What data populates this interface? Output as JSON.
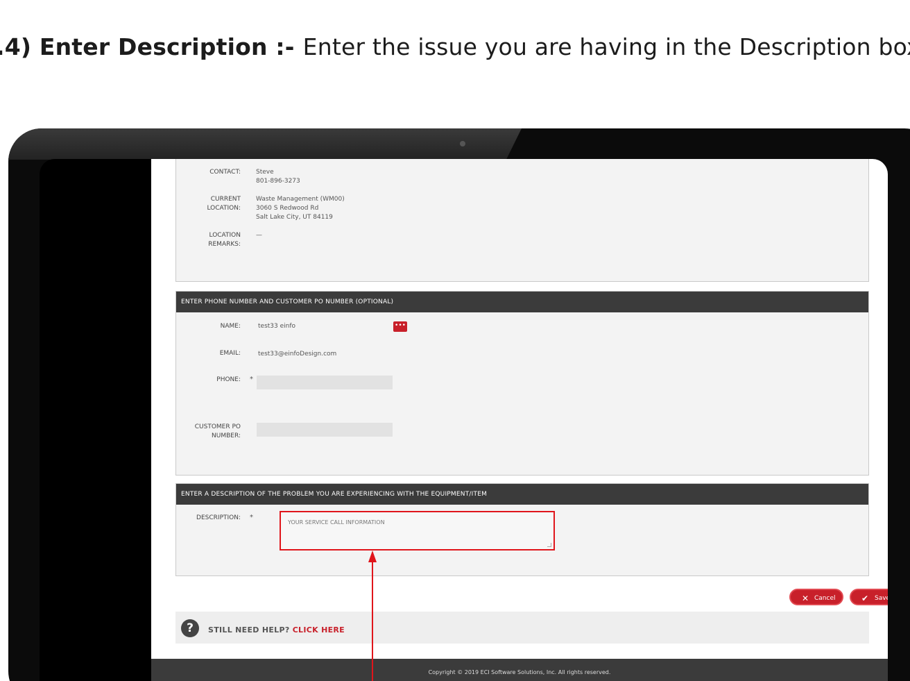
{
  "instruction": {
    "step": ".4) Enter Description :-",
    "text": "Enter the issue you are having in the Description box."
  },
  "location_panel": {
    "contact_label": "CONTACT:",
    "contact_name": "Steve",
    "contact_phone": "801-896-3273",
    "current_location_label_1": "CURRENT",
    "current_location_label_2": "LOCATION:",
    "location_line_1": "Waste Management (WM00)",
    "location_line_2": "3060 S Redwood Rd",
    "location_line_3": "Salt Lake City, UT 84119",
    "location_remarks_label_1": "LOCATION",
    "location_remarks_label_2": "REMARKS:",
    "location_remarks_value": "—"
  },
  "phone_panel": {
    "header": "ENTER PHONE NUMBER AND CUSTOMER PO NUMBER (OPTIONAL)",
    "name_label": "NAME:",
    "name_value": "test33 einfo",
    "more_button": "•••",
    "email_label": "EMAIL:",
    "email_value": "test33@einfoDesign.com",
    "phone_label": "PHONE:",
    "required_marker": "*",
    "phone_value": "",
    "po_label_1": "CUSTOMER PO",
    "po_label_2": "NUMBER:",
    "po_value": ""
  },
  "description_panel": {
    "header": "ENTER A DESCRIPTION OF THE PROBLEM YOU ARE EXPERIENCING WITH THE EQUIPMENT/ITEM",
    "description_label": "DESCRIPTION:",
    "required_marker": "*",
    "placeholder": "YOUR SERVICE CALL INFORMATION"
  },
  "actions": {
    "cancel_label": "Cancel",
    "save_label": "Save"
  },
  "help": {
    "text": "STILL NEED HELP?",
    "link": "CLICK HERE"
  },
  "footer": {
    "copyright": "Copyright © 2019 ECI Software Solutions, Inc. All rights reserved."
  },
  "colors": {
    "accent_red": "#c8202a",
    "annotation_red": "#e0151b",
    "header_dark": "#3b3b3b"
  }
}
